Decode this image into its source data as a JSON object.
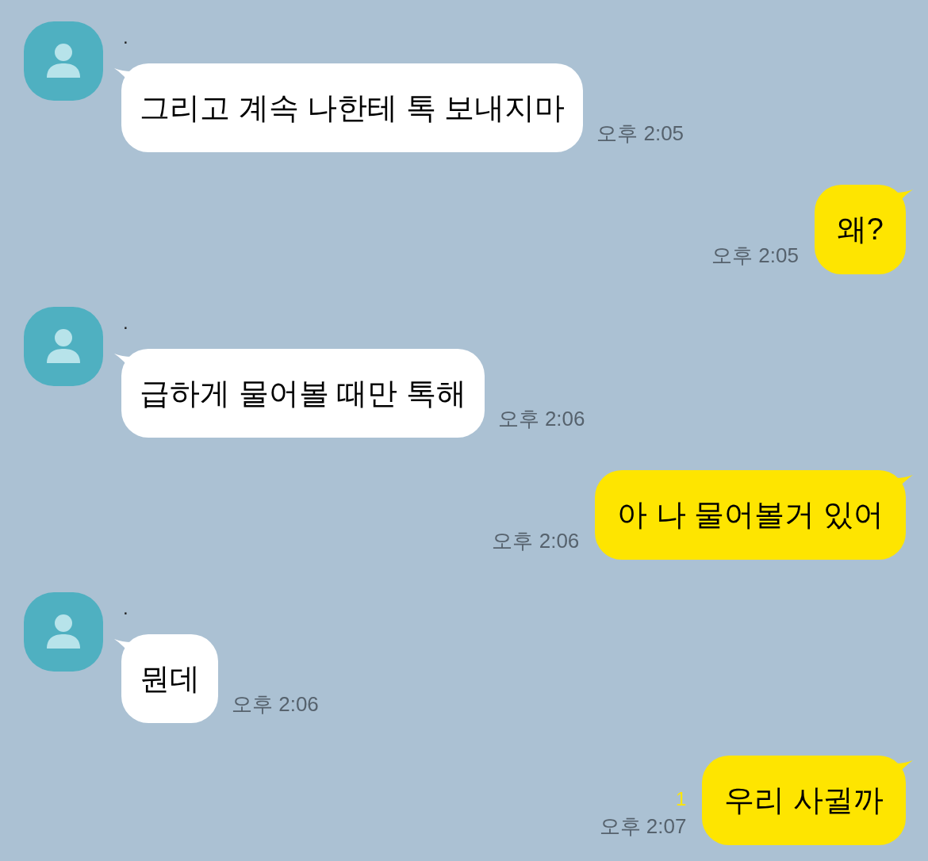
{
  "messages": [
    {
      "kind": "received",
      "sender": ".",
      "text": "그리고 계속 나한테 톡 보내지마",
      "time": "오후 2:05"
    },
    {
      "kind": "sent",
      "text": "왜?",
      "time": "오후 2:05"
    },
    {
      "kind": "received",
      "sender": ".",
      "text": "급하게 물어볼 때만 톡해",
      "time": "오후 2:06"
    },
    {
      "kind": "sent",
      "text": "아 나 물어볼거 있어",
      "time": "오후 2:06"
    },
    {
      "kind": "received",
      "sender": ".",
      "text": "뭔데",
      "time": "오후 2:06"
    },
    {
      "kind": "sent",
      "text": "우리 사귈까",
      "time": "오후 2:07",
      "unread": "1"
    }
  ]
}
